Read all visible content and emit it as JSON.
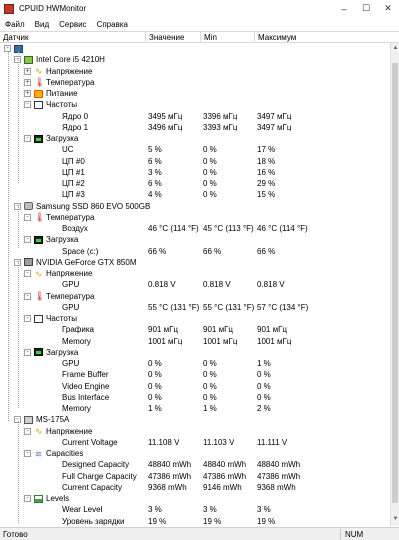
{
  "window": {
    "title": "CPUID HWMonitor",
    "minimize": "–",
    "maximize": "☐",
    "close": "✕"
  },
  "menu": [
    "Файл",
    "Вид",
    "Сервис",
    "Справка"
  ],
  "columns": [
    "Датчик",
    "Значение",
    "Min",
    "Максимум"
  ],
  "rows": [
    {
      "d": 0,
      "exp": "-",
      "icon": "pc",
      "label": "",
      "v": "",
      "mn": "",
      "mx": ""
    },
    {
      "d": 1,
      "exp": "-",
      "icon": "cpu",
      "label": "Intel Core i5 4210H",
      "v": "",
      "mn": "",
      "mx": ""
    },
    {
      "d": 2,
      "exp": "+",
      "icon": "volt",
      "label": "Напряжение",
      "v": "",
      "mn": "",
      "mx": ""
    },
    {
      "d": 2,
      "exp": "+",
      "icon": "temp",
      "label": "Температура",
      "v": "",
      "mn": "",
      "mx": ""
    },
    {
      "d": 2,
      "exp": "+",
      "icon": "power",
      "label": "Питание",
      "v": "",
      "mn": "",
      "mx": ""
    },
    {
      "d": 2,
      "exp": "-",
      "icon": "clock",
      "label": "Частоты",
      "v": "",
      "mn": "",
      "mx": ""
    },
    {
      "d": 3,
      "exp": "",
      "icon": "",
      "label": "Ядро 0",
      "v": "3495 мГц",
      "mn": "3396 мГц",
      "mx": "3497 мГц"
    },
    {
      "d": 3,
      "exp": "",
      "icon": "",
      "label": "Ядро 1",
      "v": "3496 мГц",
      "mn": "3393 мГц",
      "mx": "3497 мГц"
    },
    {
      "d": 2,
      "exp": "-",
      "icon": "load",
      "label": "Загрузка",
      "v": "",
      "mn": "",
      "mx": ""
    },
    {
      "d": 3,
      "exp": "",
      "icon": "",
      "label": "UC",
      "v": "5 %",
      "mn": "0 %",
      "mx": "17 %"
    },
    {
      "d": 3,
      "exp": "",
      "icon": "",
      "label": "ЦП #0",
      "v": "6 %",
      "mn": "0 %",
      "mx": "18 %"
    },
    {
      "d": 3,
      "exp": "",
      "icon": "",
      "label": "ЦП #1",
      "v": "3 %",
      "mn": "0 %",
      "mx": "16 %"
    },
    {
      "d": 3,
      "exp": "",
      "icon": "",
      "label": "ЦП #2",
      "v": "6 %",
      "mn": "0 %",
      "mx": "29 %"
    },
    {
      "d": 3,
      "exp": "",
      "icon": "",
      "label": "ЦП #3",
      "v": "4 %",
      "mn": "0 %",
      "mx": "15 %"
    },
    {
      "d": 1,
      "exp": "-",
      "icon": "disk",
      "label": "Samsung SSD 860 EVO 500GB",
      "v": "",
      "mn": "",
      "mx": ""
    },
    {
      "d": 2,
      "exp": "-",
      "icon": "temp",
      "label": "Температура",
      "v": "",
      "mn": "",
      "mx": ""
    },
    {
      "d": 3,
      "exp": "",
      "icon": "",
      "label": "Воздух",
      "v": "46 °C  (114 °F)",
      "mn": "45 °C  (113 °F)",
      "mx": "46 °C  (114 °F)"
    },
    {
      "d": 2,
      "exp": "-",
      "icon": "load",
      "label": "Загрузка",
      "v": "",
      "mn": "",
      "mx": ""
    },
    {
      "d": 3,
      "exp": "",
      "icon": "",
      "label": "Space (c:)",
      "v": "66 %",
      "mn": "66 %",
      "mx": "66 %"
    },
    {
      "d": 1,
      "exp": "-",
      "icon": "gpu",
      "label": "NVIDIA GeForce GTX 850M",
      "v": "",
      "mn": "",
      "mx": ""
    },
    {
      "d": 2,
      "exp": "-",
      "icon": "volt",
      "label": "Напряжение",
      "v": "",
      "mn": "",
      "mx": ""
    },
    {
      "d": 3,
      "exp": "",
      "icon": "",
      "label": "GPU",
      "v": "0.818 V",
      "mn": "0.818 V",
      "mx": "0.818 V"
    },
    {
      "d": 2,
      "exp": "-",
      "icon": "temp",
      "label": "Температура",
      "v": "",
      "mn": "",
      "mx": ""
    },
    {
      "d": 3,
      "exp": "",
      "icon": "",
      "label": "GPU",
      "v": "55 °C  (131 °F)",
      "mn": "55 °C  (131 °F)",
      "mx": "57 °C  (134 °F)"
    },
    {
      "d": 2,
      "exp": "-",
      "icon": "clock",
      "label": "Частоты",
      "v": "",
      "mn": "",
      "mx": ""
    },
    {
      "d": 3,
      "exp": "",
      "icon": "",
      "label": "Графика",
      "v": "901 мГц",
      "mn": "901 мГц",
      "mx": "901 мГц"
    },
    {
      "d": 3,
      "exp": "",
      "icon": "",
      "label": "Memory",
      "v": "1001 мГц",
      "mn": "1001 мГц",
      "mx": "1001 мГц"
    },
    {
      "d": 2,
      "exp": "-",
      "icon": "load",
      "label": "Загрузка",
      "v": "",
      "mn": "",
      "mx": ""
    },
    {
      "d": 3,
      "exp": "",
      "icon": "",
      "label": "GPU",
      "v": "0 %",
      "mn": "0 %",
      "mx": "1 %"
    },
    {
      "d": 3,
      "exp": "",
      "icon": "",
      "label": "Frame Buffer",
      "v": "0 %",
      "mn": "0 %",
      "mx": "0 %"
    },
    {
      "d": 3,
      "exp": "",
      "icon": "",
      "label": "Video Engine",
      "v": "0 %",
      "mn": "0 %",
      "mx": "0 %"
    },
    {
      "d": 3,
      "exp": "",
      "icon": "",
      "label": "Bus Interface",
      "v": "0 %",
      "mn": "0 %",
      "mx": "0 %"
    },
    {
      "d": 3,
      "exp": "",
      "icon": "",
      "label": "Memory",
      "v": "1 %",
      "mn": "1 %",
      "mx": "2 %"
    },
    {
      "d": 1,
      "exp": "-",
      "icon": "mb",
      "label": "MS-175A",
      "v": "",
      "mn": "",
      "mx": ""
    },
    {
      "d": 2,
      "exp": "-",
      "icon": "volt",
      "label": "Напряжение",
      "v": "",
      "mn": "",
      "mx": ""
    },
    {
      "d": 3,
      "exp": "",
      "icon": "",
      "label": "Current Voltage",
      "v": "11.108 V",
      "mn": "11.103 V",
      "mx": "11.111 V"
    },
    {
      "d": 2,
      "exp": "-",
      "icon": "cap",
      "label": "Capacities",
      "v": "",
      "mn": "",
      "mx": ""
    },
    {
      "d": 3,
      "exp": "",
      "icon": "",
      "label": "Designed Capacity",
      "v": "48840 mWh",
      "mn": "48840 mWh",
      "mx": "48840 mWh"
    },
    {
      "d": 3,
      "exp": "",
      "icon": "",
      "label": "Full Charge Capacity",
      "v": "47386 mWh",
      "mn": "47386 mWh",
      "mx": "47386 mWh"
    },
    {
      "d": 3,
      "exp": "",
      "icon": "",
      "label": "Current Capacity",
      "v": "9368 mWh",
      "mn": "9146 mWh",
      "mx": "9368 mWh"
    },
    {
      "d": 2,
      "exp": "-",
      "icon": "level",
      "label": "Levels",
      "v": "",
      "mn": "",
      "mx": ""
    },
    {
      "d": 3,
      "exp": "",
      "icon": "",
      "label": "Wear Level",
      "v": "3 %",
      "mn": "3 %",
      "mx": "3 %"
    },
    {
      "d": 3,
      "exp": "",
      "icon": "",
      "label": "Уровень зарядки",
      "v": "19 %",
      "mn": "19 %",
      "mx": "19 %"
    }
  ],
  "status": {
    "text": "Готово",
    "num": "NUM"
  },
  "colors": {
    "tree_line": "#a0a0a0",
    "background": "#ffffff"
  }
}
